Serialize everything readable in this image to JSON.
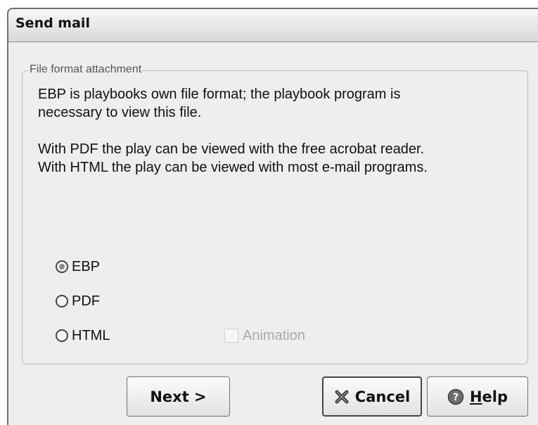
{
  "window": {
    "title": "Send mail"
  },
  "group": {
    "legend": "File format attachment",
    "description": [
      "EBP is playbooks own file format; the playbook program is",
      "necessary to view this file.",
      "",
      "With PDF the play can be viewed with the free acrobat reader.",
      "With HTML the play can be viewed with most e-mail programs."
    ]
  },
  "format_options": [
    {
      "label": "EBP",
      "selected": true
    },
    {
      "label": "PDF",
      "selected": false
    },
    {
      "label": "HTML",
      "selected": false
    }
  ],
  "animation_checkbox": {
    "label": "Animation",
    "checked": false,
    "enabled": false
  },
  "buttons": {
    "next": "Next >",
    "cancel": "Cancel",
    "cancel_icon": "close-x-icon",
    "help_mnemonic": "H",
    "help_rest": "elp",
    "help_icon": "help-icon"
  }
}
